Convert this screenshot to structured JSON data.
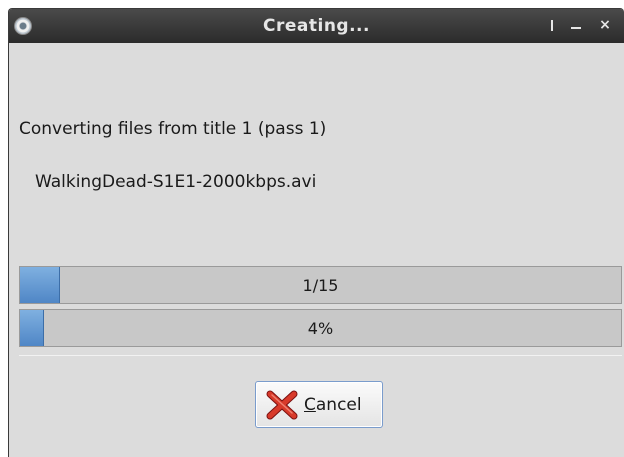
{
  "window": {
    "title": "Creating...",
    "icon": "disc-icon"
  },
  "titlebar_buttons": {
    "separator": "separator-icon",
    "minimize": "minimize-icon",
    "close": "×"
  },
  "status": {
    "message": "Converting files from title 1 (pass 1)",
    "current_file": "WalkingDead-S1E1-2000kbps.avi"
  },
  "progress": {
    "files_label": "1/15",
    "files_fraction": 0.067,
    "percent_label": "4%",
    "percent_fraction": 0.04,
    "fill_color": "#4f86c6"
  },
  "buttons": {
    "cancel_mnemonic": "C",
    "cancel_rest": "ancel",
    "cancel_icon": "red-x-icon"
  }
}
